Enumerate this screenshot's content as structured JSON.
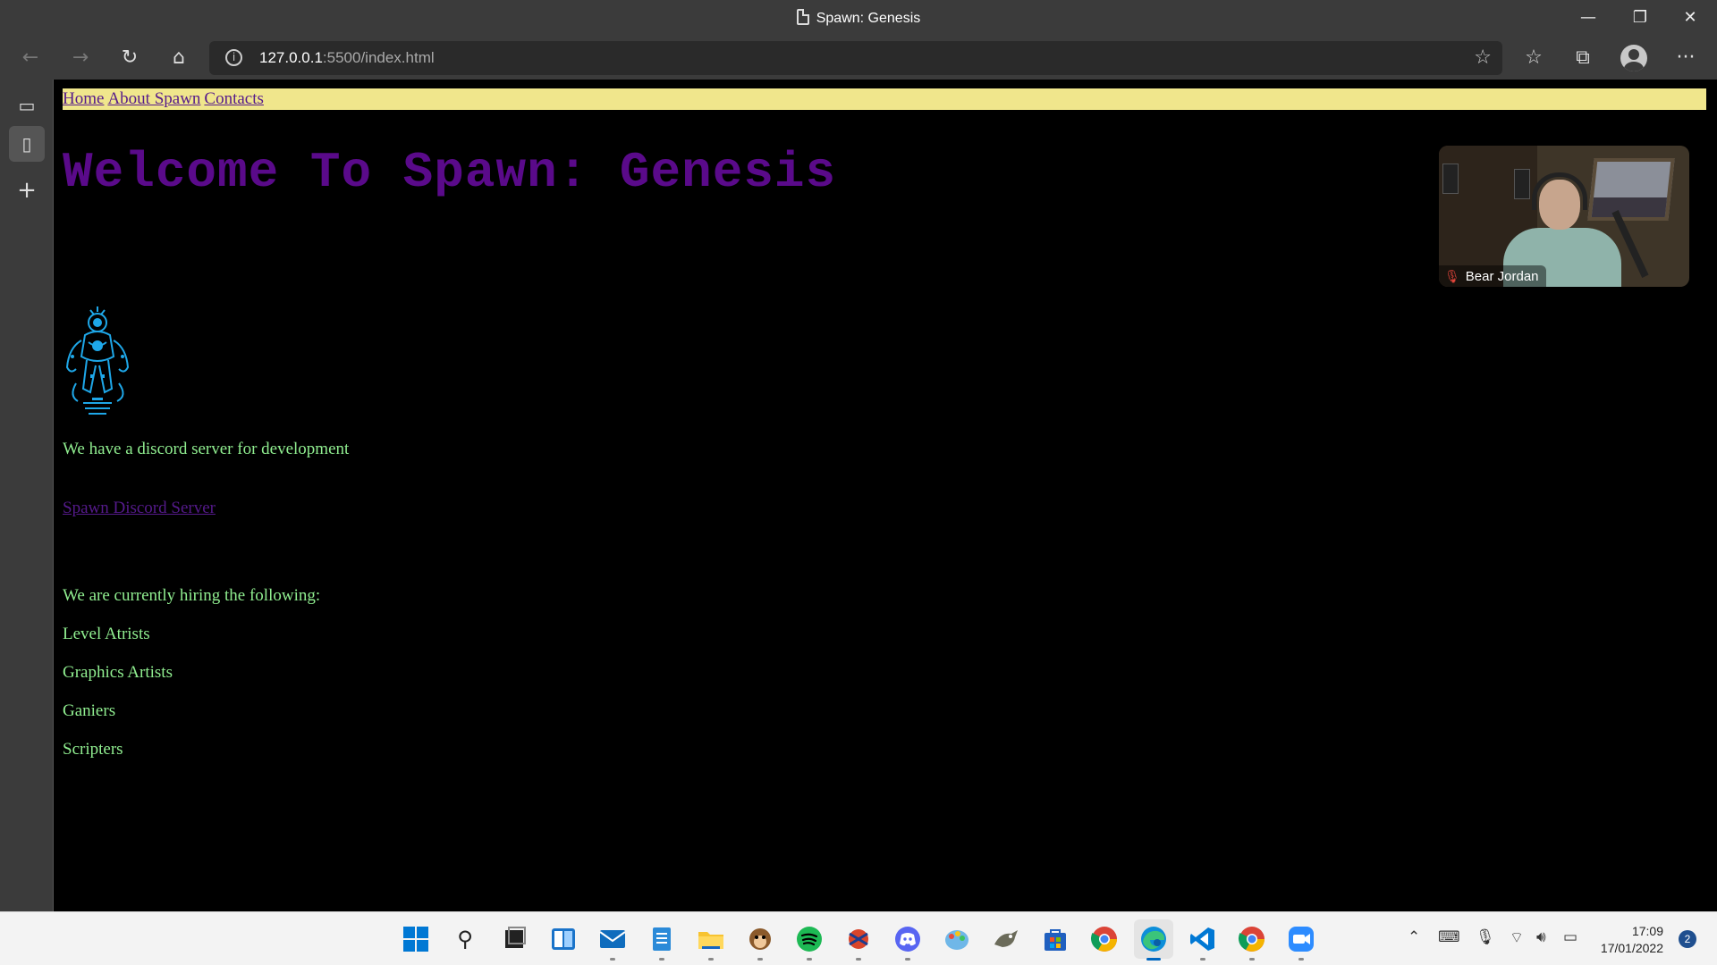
{
  "window": {
    "title": "Spawn: Genesis",
    "minimize": "—",
    "restore": "❐",
    "close": "✕"
  },
  "toolbar": {
    "back_icon": "←",
    "forward_icon": "→",
    "refresh_icon": "↻",
    "home_icon": "⌂",
    "url_host": "127.0.0.1",
    "url_rest": ":5500/index.html",
    "add_favorite_icon": "☆",
    "favorites_icon": "☆",
    "collections_icon": "⧉",
    "more_icon": "···"
  },
  "sidebar": {
    "tab_icon_1": "▭",
    "tab_icon_2": "▯",
    "add_icon": "+"
  },
  "page": {
    "nav": [
      "Home",
      "About Spawn",
      "Contacts"
    ],
    "heading": "Welcome To Spawn: Genesis",
    "discord_text": "We have a discord server for development",
    "discord_link": "Spawn Discord Server",
    "hiring_intro": "We are currently hiring the following:",
    "roles": [
      "Level Atrists",
      "Graphics Artists",
      "Ganiers",
      "Scripters"
    ],
    "colors": {
      "nav_bg": "#f0e68c",
      "heading": "#5a0a8a",
      "text": "#90ee90",
      "link": "#551a8b",
      "logo": "#1ea7e8"
    }
  },
  "video": {
    "participant_name": "Bear Jordan",
    "mic_status_icon": "mic-muted-icon"
  },
  "taskbar": {
    "apps": [
      "start",
      "search",
      "task-view",
      "widgets",
      "mail",
      "notepad",
      "file-explorer",
      "gimp-like-monkey",
      "spotify",
      "game",
      "discord",
      "paint",
      "gimp",
      "store",
      "chrome",
      "edge",
      "vscode",
      "chrome-2",
      "zoom"
    ],
    "time": "17:09",
    "date": "17/01/2022",
    "notifications": "2"
  }
}
